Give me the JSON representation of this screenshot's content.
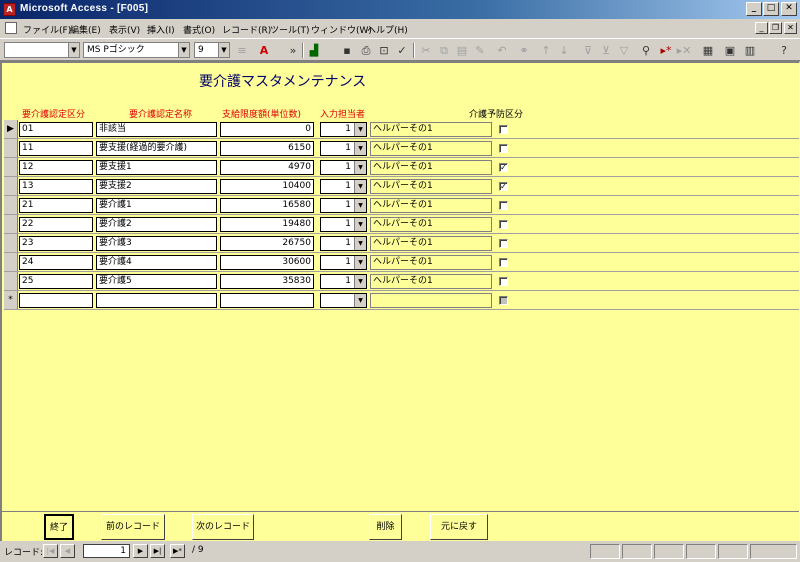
{
  "window": {
    "title": "Microsoft Access - [F005]"
  },
  "menu": [
    "ファイル(F)",
    "編集(E)",
    "表示(V)",
    "挿入(I)",
    "書式(O)",
    "レコード(R)",
    "ツール(T)",
    "ウィンドウ(W)",
    "ヘルプ(H)"
  ],
  "toolbar": {
    "font_name": "MS Pゴシック",
    "font_size": "9"
  },
  "form": {
    "title": "要介護マスタメンテナンス",
    "headers": {
      "code": "要介護認定区分",
      "name": "要介護認定名称",
      "limit": "支給限度額(単位数)",
      "staff": "入力担当者",
      "prevention": "介護予防区分"
    },
    "rows": [
      {
        "code": "01",
        "name": "非該当",
        "limit": "0",
        "staff": "1",
        "helper": "ヘルパーその1",
        "prevention": false
      },
      {
        "code": "11",
        "name": "要支援(経過的要介護)",
        "limit": "6150",
        "staff": "1",
        "helper": "ヘルパーその1",
        "prevention": false
      },
      {
        "code": "12",
        "name": "要支援1",
        "limit": "4970",
        "staff": "1",
        "helper": "ヘルパーその1",
        "prevention": true
      },
      {
        "code": "13",
        "name": "要支援2",
        "limit": "10400",
        "staff": "1",
        "helper": "ヘルパーその1",
        "prevention": true
      },
      {
        "code": "21",
        "name": "要介護1",
        "limit": "16580",
        "staff": "1",
        "helper": "ヘルパーその1",
        "prevention": false
      },
      {
        "code": "22",
        "name": "要介護2",
        "limit": "19480",
        "staff": "1",
        "helper": "ヘルパーその1",
        "prevention": false
      },
      {
        "code": "23",
        "name": "要介護3",
        "limit": "26750",
        "staff": "1",
        "helper": "ヘルパーその1",
        "prevention": false
      },
      {
        "code": "24",
        "name": "要介護4",
        "limit": "30600",
        "staff": "1",
        "helper": "ヘルパーその1",
        "prevention": false
      },
      {
        "code": "25",
        "name": "要介護5",
        "limit": "35830",
        "staff": "1",
        "helper": "ヘルパーその1",
        "prevention": false
      }
    ],
    "new_row_marker": "*",
    "current_row_marker": "▶"
  },
  "buttons": {
    "end": "終了",
    "prev": "前のレコード",
    "next": "次のレコード",
    "delete": "削除",
    "undo": "元に戻す"
  },
  "nav": {
    "label": "レコード:",
    "current": "1",
    "total": "/ 9"
  }
}
